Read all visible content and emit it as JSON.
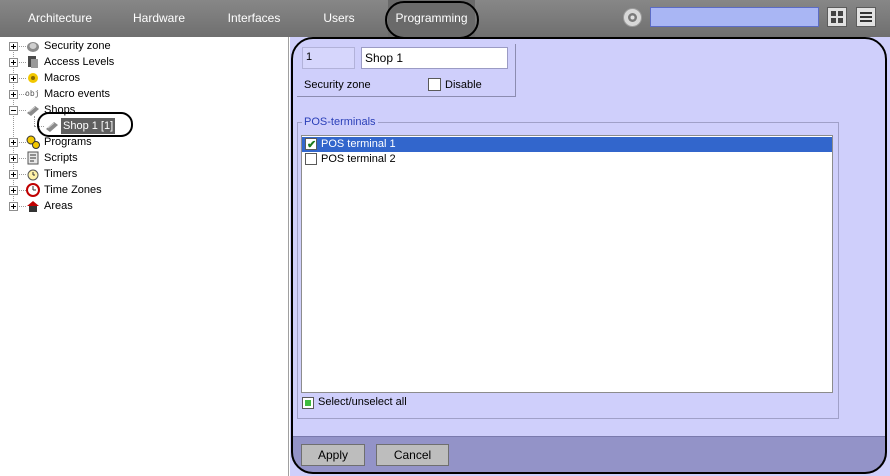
{
  "topbar": {
    "tabs": [
      "Architecture",
      "Hardware",
      "Interfaces",
      "Users",
      "Programming"
    ],
    "active_tab": "Programming",
    "search_value": ""
  },
  "tree": {
    "items": [
      {
        "label": "Security zone",
        "icon": "security-zone-icon"
      },
      {
        "label": "Access Levels",
        "icon": "access-levels-icon"
      },
      {
        "label": "Macros",
        "icon": "macros-icon"
      },
      {
        "label": "Macro events",
        "icon": "obj-icon",
        "icon_text": "obj"
      },
      {
        "label": "Shops",
        "icon": "shops-icon"
      },
      {
        "label": "Shop 1 [1]",
        "icon": "shop-icon",
        "selected": true
      },
      {
        "label": "Programs",
        "icon": "programs-icon"
      },
      {
        "label": "Scripts",
        "icon": "scripts-icon"
      },
      {
        "label": "Timers",
        "icon": "timers-icon"
      },
      {
        "label": "Time Zones",
        "icon": "time-zones-icon"
      },
      {
        "label": "Areas",
        "icon": "areas-icon"
      }
    ]
  },
  "props": {
    "id_value": "1",
    "name_value": "Shop 1",
    "security_zone_label": "Security zone",
    "disable_label": "Disable",
    "disable_checked": false
  },
  "pos_group": {
    "title": "POS-terminals",
    "items": [
      {
        "label": "POS terminal 1",
        "checked": true,
        "selected": true
      },
      {
        "label": "POS terminal 2",
        "checked": false,
        "selected": false
      }
    ],
    "select_all_label": "Select/unselect all"
  },
  "buttons": {
    "apply": "Apply",
    "cancel": "Cancel"
  },
  "colors": {
    "panel_bg": "#cfcffb",
    "selection": "#3266cc",
    "topbar": "#7a7a7a",
    "search": "#a9b6f4"
  }
}
